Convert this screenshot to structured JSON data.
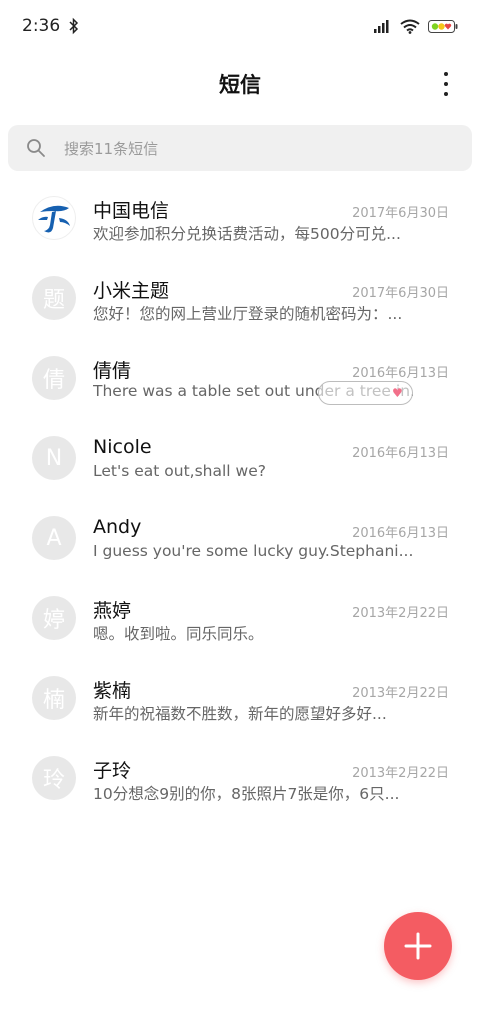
{
  "status_bar": {
    "time": "2:36"
  },
  "header": {
    "title": "短信"
  },
  "search": {
    "placeholder": "搜索11条短信"
  },
  "conversations": [
    {
      "avatar": "",
      "name": "中国电信",
      "date": "2017年6月30日",
      "snippet": "欢迎参加积分兑换话费活动，每500分可兑..."
    },
    {
      "avatar": "题",
      "name": "小米主题",
      "date": "2017年6月30日",
      "snippet": "您好！您的网上营业厅登录的随机密码为：..."
    },
    {
      "avatar": "倩",
      "name": "倩倩",
      "date": "2016年6月13日",
      "snippet": "There was a table set out under a tree in..."
    },
    {
      "avatar": "N",
      "name": "Nicole",
      "date": "2016年6月13日",
      "snippet": "Let's eat out,shall we?"
    },
    {
      "avatar": "A",
      "name": "Andy",
      "date": "2016年6月13日",
      "snippet": "I guess you're some lucky guy.Stephani..."
    },
    {
      "avatar": "婷",
      "name": "燕婷",
      "date": "2013年2月22日",
      "snippet": "嗯。收到啦。同乐同乐。"
    },
    {
      "avatar": "楠",
      "name": "紫楠",
      "date": "2013年2月22日",
      "snippet": "新年的祝福数不胜数，新年的愿望好多好..."
    },
    {
      "avatar": "玲",
      "name": "子玲",
      "date": "2013年2月22日",
      "snippet": "10分想念9别的你，8张照片7张是你，6只..."
    }
  ],
  "colors": {
    "accent": "#f45c62",
    "avatar_bg": "#e8e8e8",
    "search_bg": "#f0f0f0"
  }
}
